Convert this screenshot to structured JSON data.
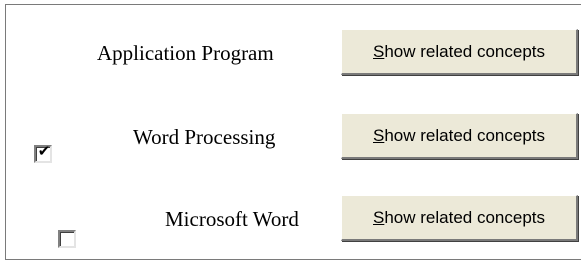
{
  "rows": [
    {
      "concept": "Application Program",
      "checkbox": null,
      "button_accel": "S",
      "button_rest": "how  related concepts"
    },
    {
      "concept": "Word Processing",
      "checkbox": {
        "checked": true,
        "mark": "✔"
      },
      "button_accel": "S",
      "button_rest": "how  related concepts"
    },
    {
      "concept": "Microsoft Word",
      "checkbox": {
        "checked": false,
        "mark": ""
      },
      "button_accel": "S",
      "button_rest": "how  related concepts"
    }
  ],
  "colors": {
    "button_face": "#ece9d8",
    "frame_border": "#7a7a7a",
    "background": "#ffffff"
  }
}
